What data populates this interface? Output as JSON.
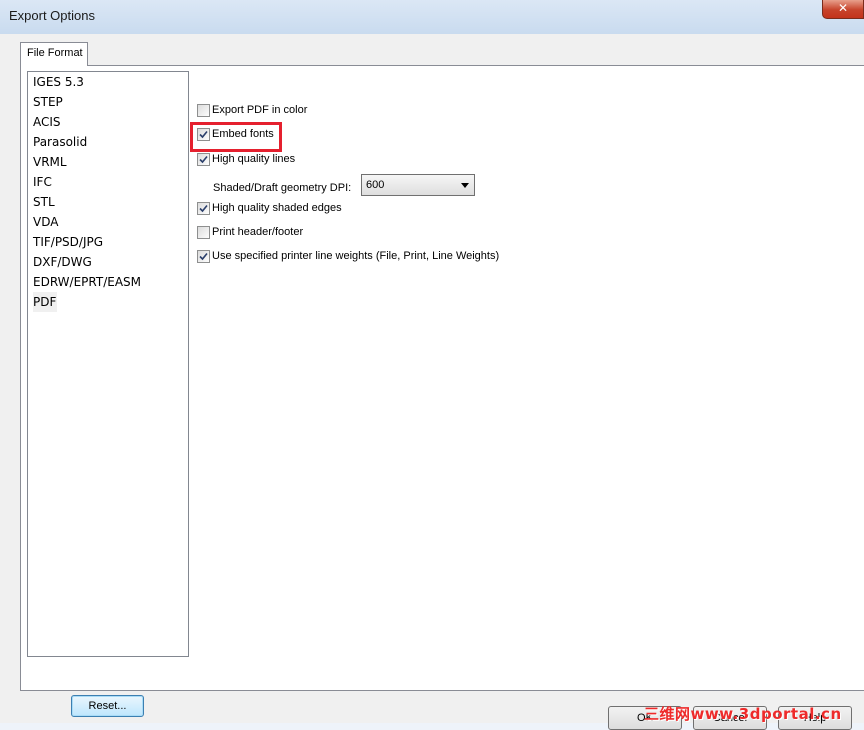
{
  "window": {
    "title": "Export Options",
    "close_label": "✕"
  },
  "tab": {
    "label": "File Format"
  },
  "formats": [
    {
      "label": "IGES 5.3"
    },
    {
      "label": "STEP"
    },
    {
      "label": "ACIS"
    },
    {
      "label": "Parasolid"
    },
    {
      "label": "VRML"
    },
    {
      "label": "IFC"
    },
    {
      "label": "STL"
    },
    {
      "label": "VDA"
    },
    {
      "label": "TIF/PSD/JPG"
    },
    {
      "label": "DXF/DWG"
    },
    {
      "label": "EDRW/EPRT/EASM"
    },
    {
      "label": "PDF",
      "selected": true
    }
  ],
  "options": [
    {
      "label": "Export PDF in color",
      "checked": false
    },
    {
      "label": "Embed fonts",
      "checked": true
    },
    {
      "label": "High quality lines",
      "checked": true
    },
    {
      "label": "High quality shaded edges",
      "checked": true
    },
    {
      "label": "Print header/footer",
      "checked": false
    },
    {
      "label": "Use specified printer line weights (File, Print, Line Weights)",
      "checked": true
    }
  ],
  "dpi": {
    "label": "Shaded/Draft geometry DPI:",
    "value": "600"
  },
  "reset_label": "Reset...",
  "footer": {
    "ok": "OK",
    "cancel": "Cancel",
    "help": "Help"
  },
  "watermark": "三维网www.3dportal.cn",
  "colors": {
    "highlight": "#e5202e",
    "watermark": "#ee2a2a",
    "titlebar": "#c9dbef"
  }
}
